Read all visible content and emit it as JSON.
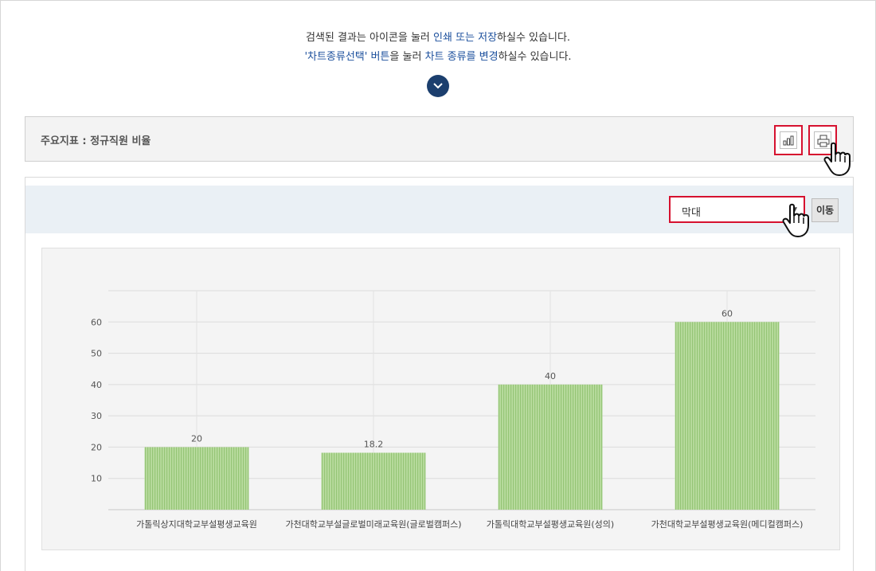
{
  "intro": {
    "line1_a": "검색된 결과는 아이콘을 눌러 ",
    "line1_hl": "인쇄 또는 저장",
    "line1_b": "하실수 있습니다.",
    "line2_hl1": "'차트종류선택' 버튼",
    "line2_a": "을 눌러 ",
    "line2_hl2": "차트 종류를 변경",
    "line2_b": "하실수 있습니다."
  },
  "indicator": {
    "title": "주요지표 : 정규직원 비율"
  },
  "icons": {
    "expand": "chevron-down-icon",
    "chart_type": "bar-chart-icon",
    "print": "printer-icon",
    "pointer": "pointing-hand-icon"
  },
  "toolbar": {
    "select_value": "막대",
    "go_label": "이동"
  },
  "colors": {
    "accent": "#1b4f9c",
    "highlight_border": "#d6112f",
    "bar_fill": "#a9d18e",
    "expand_button": "#1c3f6e"
  },
  "chart_data": {
    "type": "bar",
    "categories": [
      "가톨릭상지대학교부설평생교육원",
      "가천대학교부설글로벌미래교육원(글로벌캠퍼스)",
      "가톨릭대학교부설평생교육원(성의)",
      "가천대학교부설평생교육원(메디컬캠퍼스)"
    ],
    "values": [
      20,
      18.2,
      40,
      60
    ],
    "data_labels": [
      "20",
      "18.2",
      "40",
      "60"
    ],
    "yticks": [
      10,
      20,
      30,
      40,
      50,
      60
    ],
    "ylim": [
      0,
      70
    ],
    "grid": true,
    "legend": "none"
  }
}
